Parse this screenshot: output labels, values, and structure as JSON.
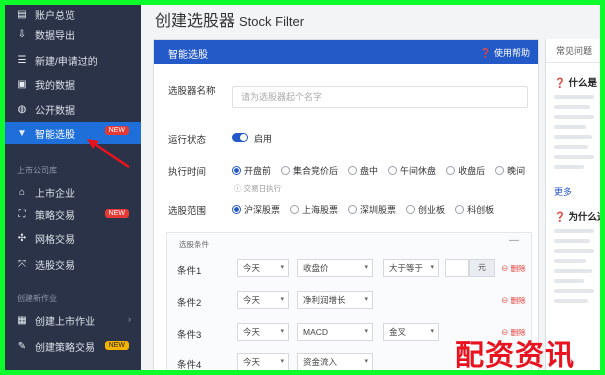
{
  "header": {
    "title": "创建选股器",
    "title_en": "Stock Filter"
  },
  "sidebar": {
    "items": [
      {
        "label": "账户总览",
        "icon": "chart-icon"
      },
      {
        "label": "数据导出",
        "icon": "download-icon"
      },
      {
        "label": "新建/申请过的",
        "icon": "list-icon"
      },
      {
        "label": "我的数据",
        "icon": "file-icon"
      },
      {
        "label": "公开数据",
        "icon": "globe-icon"
      },
      {
        "label": "智能选股",
        "icon": "filter-icon",
        "badge": "NEW"
      },
      {
        "label": "上市企业",
        "icon": "building-icon"
      },
      {
        "label": "策略交易",
        "icon": "flow-icon",
        "badge": "NEW"
      },
      {
        "label": "网格交易",
        "icon": "grid-icon"
      },
      {
        "label": "选股交易",
        "icon": "swap-icon"
      },
      {
        "label": "创建上市作业",
        "icon": "doc-icon"
      },
      {
        "label": "创建策略交易",
        "icon": "edit-icon",
        "badge": "NEW"
      }
    ],
    "sections": [
      "上市公司库",
      "创建新作业"
    ]
  },
  "panel": {
    "title": "智能选股",
    "help": "使用帮助",
    "name_label": "选股器名称",
    "name_placeholder": "请为选股器起个名字",
    "status_label": "运行状态",
    "status_value": "启用",
    "exec_label": "执行时间",
    "exec_options": [
      "开盘前",
      "集合竞价后",
      "盘中",
      "午间休盘",
      "收盘后",
      "晚间"
    ],
    "exec_hint": "交易日执行",
    "scope_label": "选股范围",
    "scope_options": [
      "沪深股票",
      "上海股票",
      "深圳股票",
      "创业板",
      "科创板"
    ],
    "conditions_title": "选股条件",
    "collapse": "—",
    "conditions": [
      {
        "label": "条件1",
        "day": "今天",
        "field": "收盘价",
        "op": "大于等于",
        "unit": "元",
        "delete": "删除"
      },
      {
        "label": "条件2",
        "day": "今天",
        "field": "净利润增长",
        "op": "",
        "unit": "",
        "delete": "删除"
      },
      {
        "label": "条件3",
        "day": "今天",
        "field": "MACD",
        "op": "金叉",
        "unit": "",
        "delete": "删除"
      },
      {
        "label": "条件4",
        "day": "今天",
        "field": "资金流入",
        "op": "",
        "unit": "",
        "delete": "删除"
      }
    ]
  },
  "right_panel": {
    "tab": "常见问题",
    "q1": "什么是",
    "q2": "为什么选",
    "link": "更多"
  },
  "watermark": "配资资讯",
  "colors": {
    "accent": "#2459c8",
    "sidebar": "#2b3348",
    "badge": "#e53935",
    "frame": "#0cfc2c"
  }
}
